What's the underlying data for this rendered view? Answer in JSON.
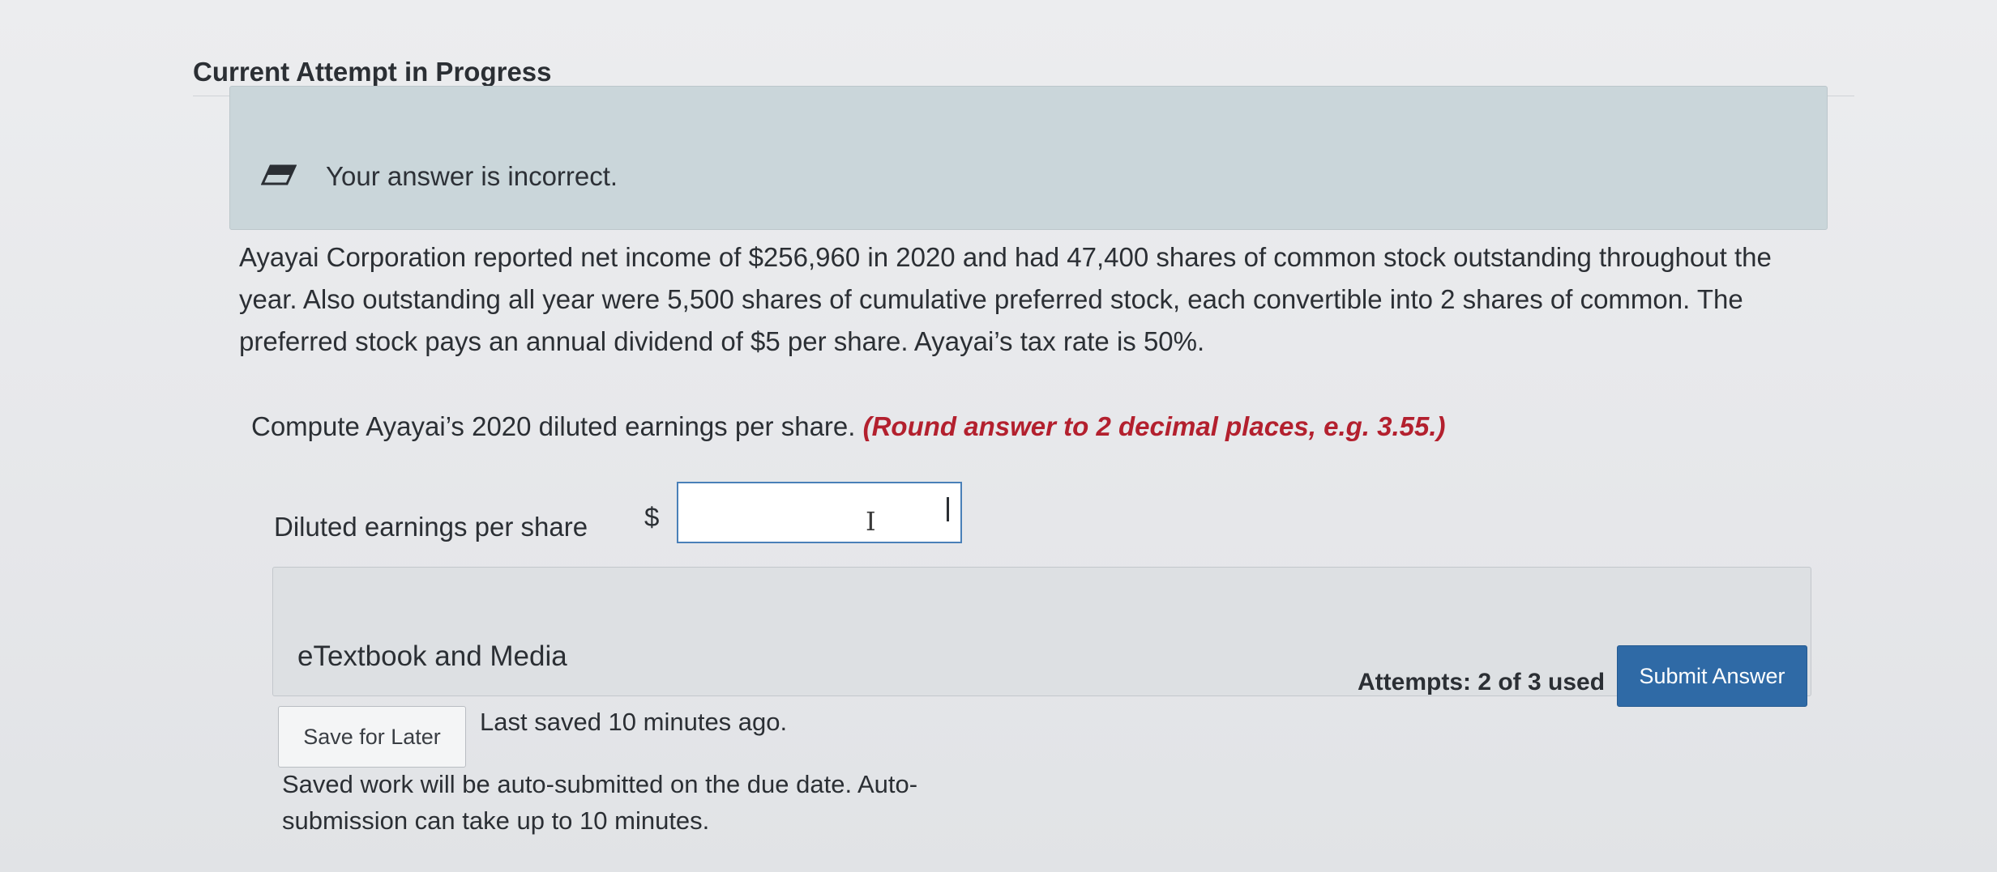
{
  "header": {
    "title": "Current Attempt in Progress"
  },
  "feedback": {
    "icon": "eraser-icon",
    "message": "Your answer is incorrect.",
    "background_color": "#cad6da"
  },
  "question": {
    "problem_text": "Ayayai Corporation reported net income of $256,960 in 2020 and had 47,400 shares of common stock outstanding throughout the year. Also outstanding all year were 5,500 shares of cumulative preferred stock, each convertible into 2 shares of common. The preferred stock pays an annual dividend of $5 per share. Ayayai’s tax rate is 50%.",
    "instruction": "Compute Ayayai’s 2020 diluted earnings per share.",
    "hint": "(Round answer to 2 decimal places, e.g. 3.55.)",
    "hint_color": "#b3202e"
  },
  "answer": {
    "label": "Diluted earnings per share",
    "currency_symbol": "$",
    "value": ""
  },
  "media": {
    "label": "eTextbook and Media"
  },
  "footer": {
    "attempts": "Attempts: 2 of 3 used",
    "submit_label": "Submit Answer",
    "submit_color": "#2f6aa6",
    "save_label": "Save for Later",
    "last_saved": "Last saved 10 minutes ago.",
    "auto_submit_note": "Saved work will be auto-submitted on the due date. Auto-submission can take up to 10 minutes."
  }
}
